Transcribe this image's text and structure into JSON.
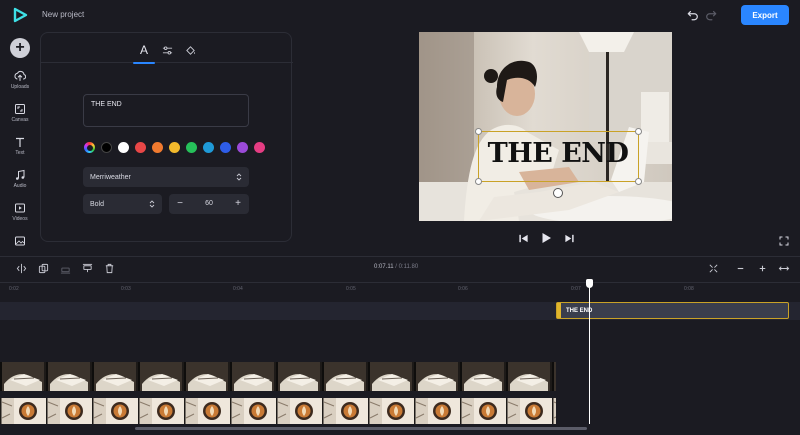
{
  "app": {
    "project_title": "New project",
    "export_label": "Export",
    "brand_color": "#2a86ff"
  },
  "rail": {
    "items": [
      {
        "label": "Uploads",
        "icon": "upload-icon"
      },
      {
        "label": "Canvas",
        "icon": "canvas-icon"
      },
      {
        "label": "Text",
        "icon": "text-icon"
      },
      {
        "label": "Audio",
        "icon": "audio-icon"
      },
      {
        "label": "Videos",
        "icon": "video-icon"
      },
      {
        "label": "",
        "icon": "image-icon"
      }
    ]
  },
  "text_panel": {
    "tabs": [
      "text-style-tab",
      "adjust-tab",
      "fill-tab"
    ],
    "text_value": "THE END",
    "colors": [
      "#000000",
      "#ffffff",
      "#e84747",
      "#f07a2f",
      "#f2b92c",
      "#26c05a",
      "#1f9ad8",
      "#2e5de8",
      "#9b4ad8",
      "#e53d83"
    ],
    "font": "Merriweather",
    "weight": "Bold",
    "size": "60"
  },
  "preview": {
    "overlay_text": "THE END"
  },
  "timeline": {
    "current_time": "0:07.11",
    "separator": "/",
    "total_time": "0:11.80",
    "ticks": [
      "0:02",
      "0:03",
      "0:04",
      "0:05",
      "0:06",
      "0:07",
      "0:08"
    ],
    "text_clip_label": "THE END",
    "playhead_fraction": 0.603
  }
}
